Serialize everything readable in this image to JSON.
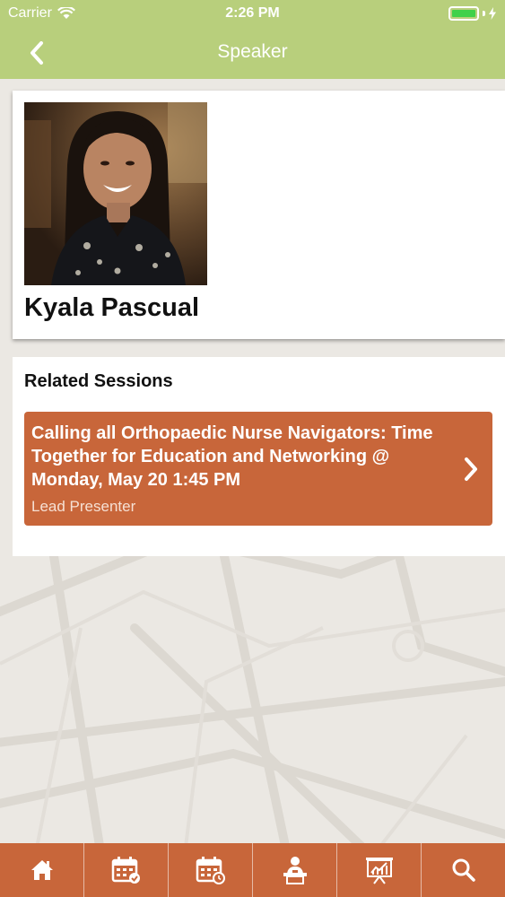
{
  "status_bar": {
    "carrier": "Carrier",
    "time": "2:26 PM"
  },
  "nav": {
    "title": "Speaker",
    "back_icon": "chevron-left-icon"
  },
  "speaker": {
    "name": "Kyala Pascual",
    "photo": "speaker-photo"
  },
  "sessions": {
    "heading": "Related Sessions",
    "items": [
      {
        "title": "Calling all Orthopaedic Nurse Navigators: Time Together for Education and Networking @ Monday, May 20 1:45 PM",
        "role": "Lead Presenter"
      }
    ]
  },
  "tabs": [
    {
      "icon": "home-icon"
    },
    {
      "icon": "calendar-check-icon"
    },
    {
      "icon": "calendar-clock-icon"
    },
    {
      "icon": "speaker-podium-icon"
    },
    {
      "icon": "presentation-chart-icon"
    },
    {
      "icon": "search-icon"
    }
  ],
  "colors": {
    "header": "#b8cf7c",
    "accent": "#c8663a",
    "background": "#ebe8e3"
  }
}
